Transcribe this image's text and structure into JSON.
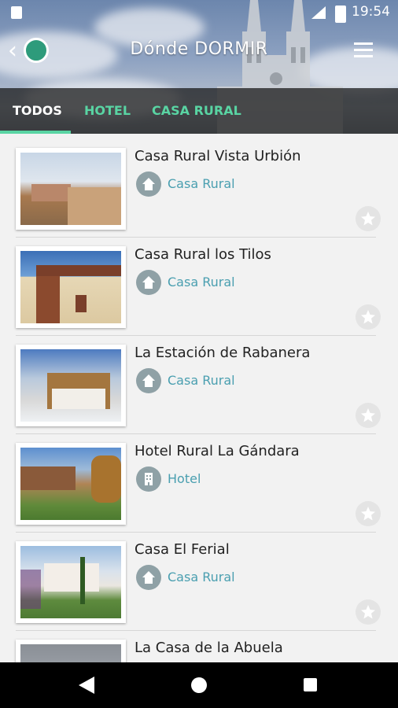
{
  "status_bar": {
    "time": "19:54",
    "sd_icon": "sd-card-icon",
    "signal_icon": "signal-icon",
    "battery_icon": "battery-icon"
  },
  "header": {
    "title": "Dónde DORMIR",
    "back_icon": "back-chevron-icon",
    "logo_icon": "globe-icon",
    "menu_icon": "hamburger-menu-icon"
  },
  "tabs": [
    {
      "label": "TODOS",
      "selected": true
    },
    {
      "label": "HOTEL",
      "selected": false
    },
    {
      "label": "CASA RURAL",
      "selected": false
    }
  ],
  "colors": {
    "accent": "#59d4a3",
    "category_text": "#4a9fb0",
    "category_icon_bg": "#8fa1a6"
  },
  "items": [
    {
      "name": "Casa Rural Vista Urbión",
      "category": "Casa Rural",
      "category_icon": "house-icon",
      "favorite_icon": "star-icon"
    },
    {
      "name": "Casa Rural los Tilos",
      "category": "Casa Rural",
      "category_icon": "house-icon",
      "favorite_icon": "star-icon"
    },
    {
      "name": "La Estación de Rabanera",
      "category": "Casa Rural",
      "category_icon": "house-icon",
      "favorite_icon": "star-icon"
    },
    {
      "name": "Hotel Rural La Gándara",
      "category": "Hotel",
      "category_icon": "hotel-icon",
      "favorite_icon": "star-icon"
    },
    {
      "name": "Casa El Ferial",
      "category": "Casa Rural",
      "category_icon": "house-icon",
      "favorite_icon": "star-icon"
    },
    {
      "name": "La Casa de la Abuela",
      "category": "",
      "category_icon": "",
      "favorite_icon": ""
    }
  ],
  "nav_bar": {
    "back_icon": "nav-back-icon",
    "home_icon": "nav-home-icon",
    "recents_icon": "nav-recents-icon"
  }
}
